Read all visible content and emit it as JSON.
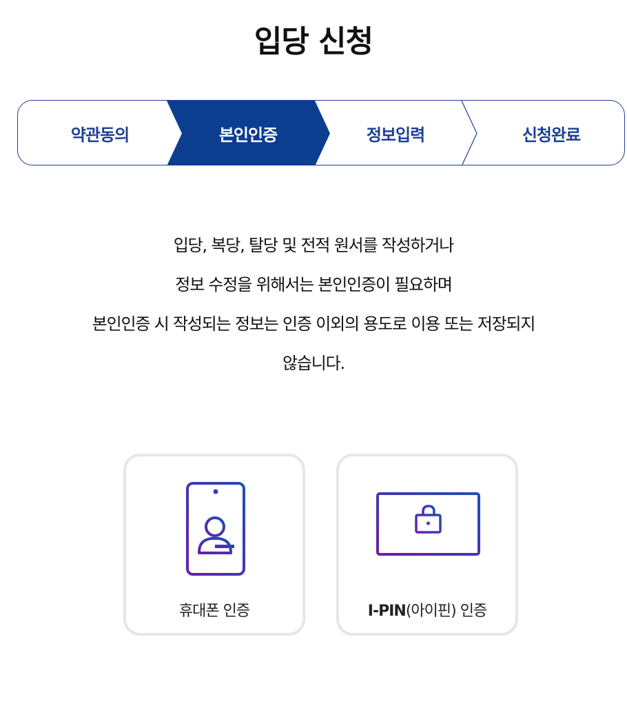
{
  "page": {
    "title": "입당 신청"
  },
  "stepper": {
    "steps": [
      {
        "label": "약관동의",
        "state": "done"
      },
      {
        "label": "본인인증",
        "state": "active"
      },
      {
        "label": "정보입력",
        "state": "pending"
      },
      {
        "label": "신청완료",
        "state": "pending"
      }
    ]
  },
  "notice": {
    "lines": [
      "입당, 복당, 탈당 및 전적 원서를 작성하거나",
      "정보 수정을 위해서는 본인인증이 필요하며",
      "본인인증 시 작성되는 정보는 인증 이외의 용도로 이용 또는 저장되지",
      "않습니다."
    ]
  },
  "auth_options": {
    "phone": {
      "label": "휴대폰 인증",
      "icon": "phone-user-icon"
    },
    "ipin": {
      "label_strong": "I-PIN",
      "label_rest": "(아이핀) 인증",
      "icon": "monitor-lock-icon"
    }
  },
  "colors": {
    "primary": "#0b3d91",
    "step_text": "#1c3f94",
    "card_border": "#e6e6e6",
    "icon_gradient_start": "#6a1fa8",
    "icon_gradient_end": "#1d4fb3"
  }
}
